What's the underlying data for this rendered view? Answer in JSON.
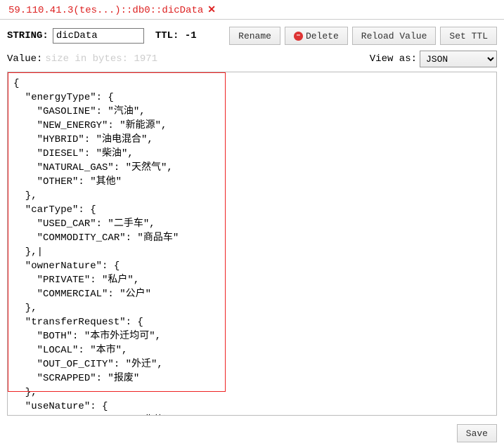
{
  "tab": {
    "title": "59.110.41.3(tes...)::db0::dicData"
  },
  "toolbar": {
    "string_label": "STRING:",
    "key_value": "dicData",
    "ttl_label": "TTL:",
    "ttl_value": "-1",
    "rename_label": "Rename",
    "delete_label": "Delete",
    "reload_label": "Reload Value",
    "setttl_label": "Set TTL"
  },
  "value_row": {
    "label": "Value:",
    "size_text": "size in bytes: 1971",
    "view_as_label": "View as:",
    "view_as_value": "JSON"
  },
  "editor_text": "{\n  \"energyType\": {\n    \"GASOLINE\": \"汽油\",\n    \"NEW_ENERGY\": \"新能源\",\n    \"HYBRID\": \"油电混合\",\n    \"DIESEL\": \"柴油\",\n    \"NATURAL_GAS\": \"天然气\",\n    \"OTHER\": \"其他\"\n  },\n  \"carType\": {\n    \"USED_CAR\": \"二手车\",\n    \"COMMODITY_CAR\": \"商品车\"\n  },|\n  \"ownerNature\": {\n    \"PRIVATE\": \"私户\",\n    \"COMMERCIAL\": \"公户\"\n  },\n  \"transferRequest\": {\n    \"BOTH\": \"本市外迁均可\",\n    \"LOCAL\": \"本市\",\n    \"OUT_OF_CITY\": \"外迁\",\n    \"SCRAPPED\": \"报废\"\n  },\n  \"useNature\": {\n    \"NON_OPERATING\": \"非营运\",",
  "footer": {
    "save_label": "Save"
  }
}
